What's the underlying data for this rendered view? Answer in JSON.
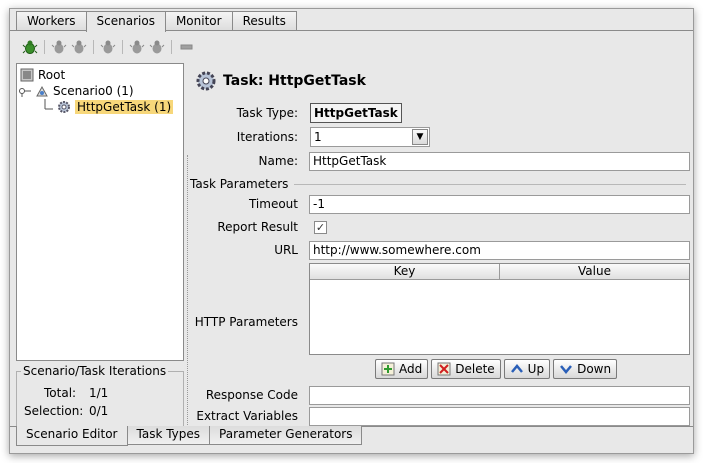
{
  "top_tabs": [
    "Workers",
    "Scenarios",
    "Monitor",
    "Results"
  ],
  "active_top_tab": "Scenarios",
  "toolbar": {
    "icons": [
      "bug-add-icon",
      "bug-icon",
      "bug-icon",
      "bug-icon",
      "bug-icon",
      "bug-icon",
      "remove-icon"
    ]
  },
  "tree": {
    "root": "Root",
    "scenario": "Scenario0 (1)",
    "task": "HttpGetTask (1)"
  },
  "iterations_box": {
    "title": "Scenario/Task Iterations",
    "total_label": "Total:",
    "total_value": "1/1",
    "selection_label": "Selection:",
    "selection_value": "0/1"
  },
  "bottom_tabs": [
    "Scenario Editor",
    "Task Types",
    "Parameter Generators"
  ],
  "task_panel": {
    "title": "Task: HttpGetTask",
    "task_type_label": "Task Type:",
    "task_type_value": "HttpGetTask",
    "iterations_label": "Iterations:",
    "iterations_value": "1",
    "name_label": "Name:",
    "name_value": "HttpGetTask",
    "section_title": "Task Parameters",
    "timeout_label": "Timeout",
    "timeout_value": "-1",
    "report_result_label": "Report Result",
    "report_result_checked": true,
    "url_label": "URL",
    "url_value": "http://www.somewhere.com",
    "http_params_label": "HTTP Parameters",
    "table_columns": [
      "Key",
      "Value"
    ],
    "buttons": {
      "add": "Add",
      "delete": "Delete",
      "up": "Up",
      "down": "Down"
    },
    "response_code_label": "Response Code",
    "response_code_value": "",
    "extract_variables_label": "Extract Variables",
    "extract_variables_value": ""
  }
}
